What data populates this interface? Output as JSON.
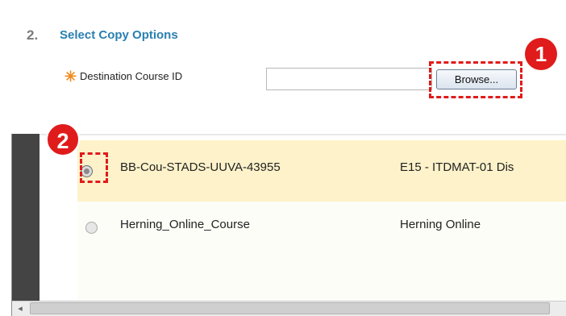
{
  "section": {
    "number": "2.",
    "title": "Select Copy Options"
  },
  "destination": {
    "required_icon": "asterisk-icon",
    "label": "Destination Course ID",
    "value": "",
    "browse_label": "Browse..."
  },
  "callouts": {
    "first": "1",
    "second": "2"
  },
  "courses": [
    {
      "id": "BB-Cou-STADS-UUVA-43955",
      "name": "E15 - ITDMAT-01 Dis",
      "selected": true
    },
    {
      "id": "Herning_Online_Course",
      "name": "Herning Online",
      "selected": false
    }
  ],
  "scrollbar": {
    "left_arrow": "◂"
  },
  "colors": {
    "accent": "#2a7fb0",
    "callout": "#e01b1b",
    "selected_row": "#fdf2ca",
    "required": "#f08a1e"
  }
}
